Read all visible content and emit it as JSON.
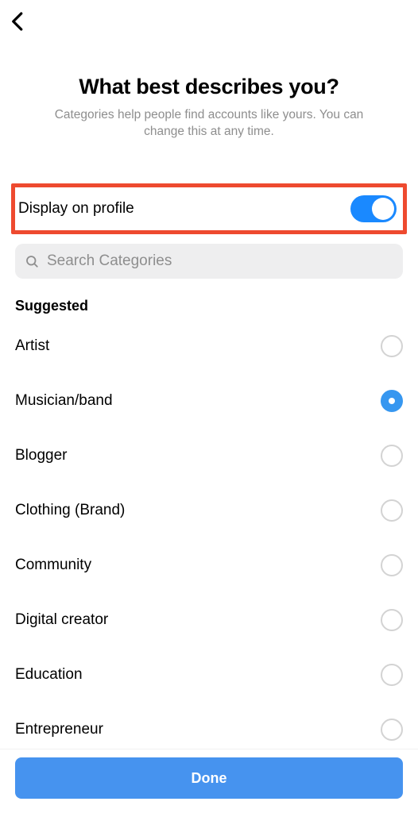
{
  "header": {
    "title": "What best describes you?",
    "subtitle": "Categories help people find accounts like yours. You can change this at any time."
  },
  "toggle": {
    "label": "Display on profile",
    "on": true
  },
  "search": {
    "placeholder": "Search Categories"
  },
  "section": {
    "heading": "Suggested"
  },
  "categories": [
    {
      "label": "Artist",
      "selected": false
    },
    {
      "label": "Musician/band",
      "selected": true
    },
    {
      "label": "Blogger",
      "selected": false
    },
    {
      "label": "Clothing (Brand)",
      "selected": false
    },
    {
      "label": "Community",
      "selected": false
    },
    {
      "label": "Digital creator",
      "selected": false
    },
    {
      "label": "Education",
      "selected": false
    },
    {
      "label": "Entrepreneur",
      "selected": false
    }
  ],
  "done": {
    "label": "Done"
  }
}
